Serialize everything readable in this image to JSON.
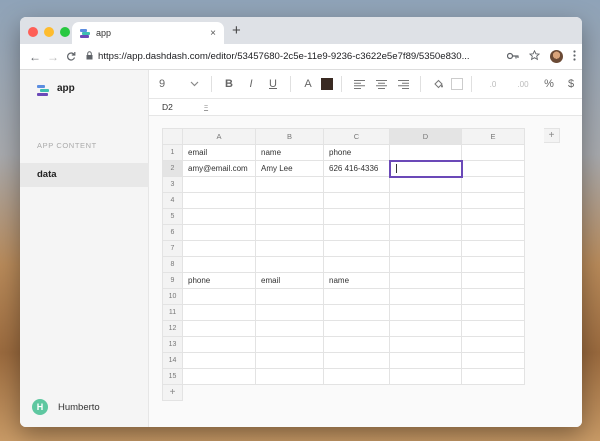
{
  "browser": {
    "tab_title": "app",
    "tab_close": "×",
    "new_tab": "+",
    "url": "https://app.dashdash.com/editor/53457680-2c5e-11e9-9236-c3622e5e7f89/5350e830...",
    "nav": {
      "back": "←",
      "forward": "→",
      "reload": "C"
    },
    "icons": [
      "key-icon",
      "star-icon",
      "menu-dots-icon"
    ]
  },
  "sidebar": {
    "app_name": "app",
    "section_label": "APP CONTENT",
    "section_add": "+",
    "items": [
      {
        "label": "data"
      }
    ],
    "user": {
      "initial": "H",
      "name": "Humberto"
    }
  },
  "toolbar": {
    "font_size": "9",
    "bold": "B",
    "italic": "I",
    "underline": "U",
    "text_color_letter": "A",
    "text_color_hex": "#3a2a22",
    "align": [
      "align-left-icon",
      "align-center-icon",
      "align-right-icon"
    ],
    "fill_icon": "paint-bucket-icon",
    "decimal": ".0",
    "decimal_more": ".00",
    "percent": "%",
    "currency": "$"
  },
  "formula_bar": {
    "cell_ref": "D2",
    "fx": "="
  },
  "sheet": {
    "columns": [
      "A",
      "B",
      "C",
      "D",
      "E"
    ],
    "add_col": "+",
    "add_row": "+",
    "rows": [
      {
        "n": "1",
        "cells": [
          "email",
          "name",
          "phone",
          "",
          ""
        ]
      },
      {
        "n": "2",
        "cells": [
          "amy@email.com",
          "Amy Lee",
          "626 416-4336",
          "",
          ""
        ]
      },
      {
        "n": "3",
        "cells": [
          "",
          "",
          "",
          "",
          ""
        ]
      },
      {
        "n": "4",
        "cells": [
          "",
          "",
          "",
          "",
          ""
        ]
      },
      {
        "n": "5",
        "cells": [
          "",
          "",
          "",
          "",
          ""
        ]
      },
      {
        "n": "6",
        "cells": [
          "",
          "",
          "",
          "",
          ""
        ]
      },
      {
        "n": "7",
        "cells": [
          "",
          "",
          "",
          "",
          ""
        ]
      },
      {
        "n": "8",
        "cells": [
          "",
          "",
          "",
          "",
          ""
        ]
      },
      {
        "n": "9",
        "cells": [
          "phone",
          "email",
          "name",
          "",
          ""
        ]
      },
      {
        "n": "10",
        "cells": [
          "",
          "",
          "",
          "",
          ""
        ]
      },
      {
        "n": "11",
        "cells": [
          "",
          "",
          "",
          "",
          ""
        ]
      },
      {
        "n": "12",
        "cells": [
          "",
          "",
          "",
          "",
          ""
        ]
      },
      {
        "n": "13",
        "cells": [
          "",
          "",
          "",
          "",
          ""
        ]
      },
      {
        "n": "14",
        "cells": [
          "",
          "",
          "",
          "",
          ""
        ]
      },
      {
        "n": "15",
        "cells": [
          "",
          "",
          "",
          "",
          ""
        ]
      }
    ],
    "active_cell": {
      "row": 2,
      "col": "D"
    }
  },
  "colors": {
    "accent": "#6b49b8",
    "logo_purple": "#6b49b8",
    "logo_teal": "#3dbfb0",
    "logo_blue": "#5b8de0"
  }
}
